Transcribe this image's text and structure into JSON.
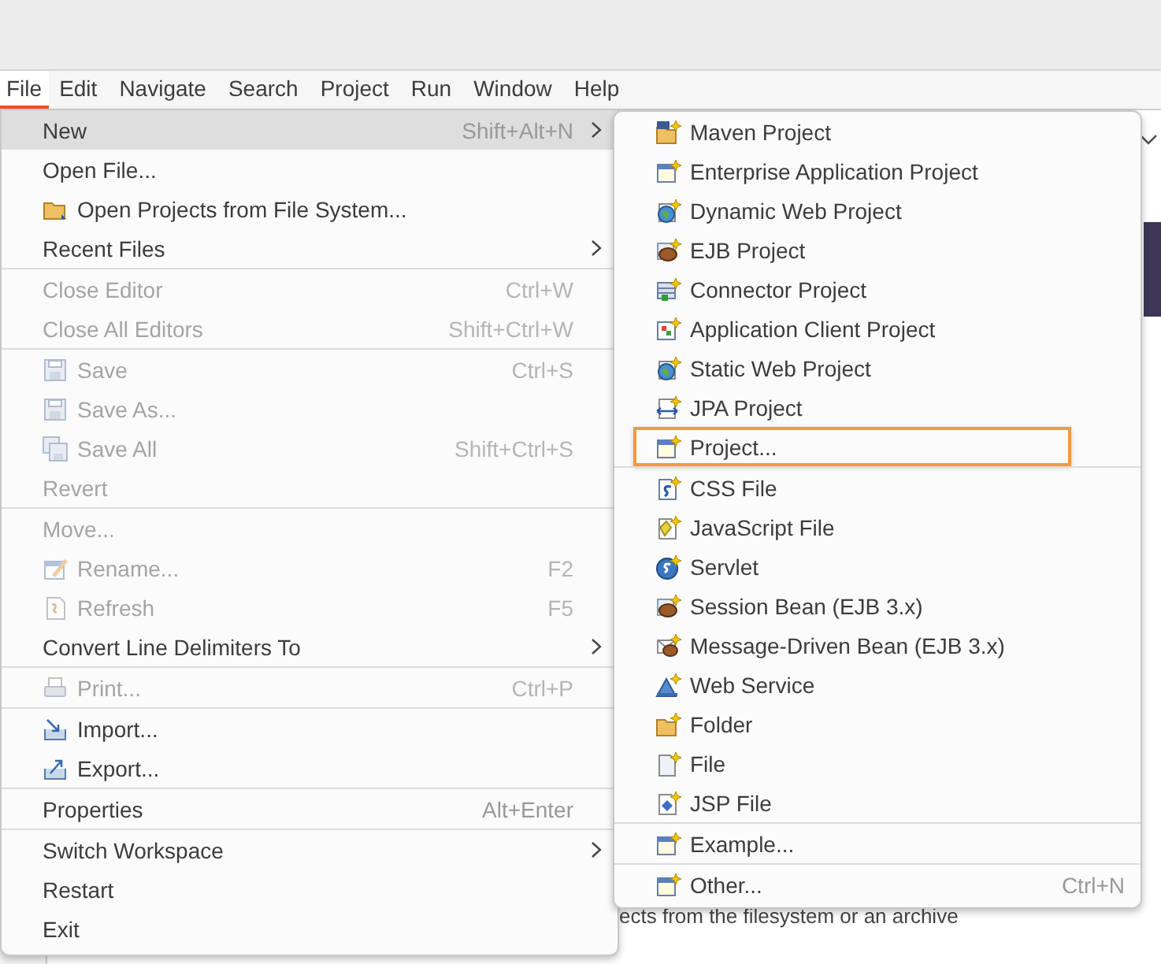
{
  "menubar": [
    {
      "label": "File",
      "selected": true
    },
    {
      "label": "Edit",
      "selected": false
    },
    {
      "label": "Navigate",
      "selected": false
    },
    {
      "label": "Search",
      "selected": false
    },
    {
      "label": "Project",
      "selected": false
    },
    {
      "label": "Run",
      "selected": false
    },
    {
      "label": "Window",
      "selected": false
    },
    {
      "label": "Help",
      "selected": false
    }
  ],
  "background": {
    "text": "ects from the filesystem or an archive"
  },
  "file_menu": {
    "groups": [
      [
        {
          "label": "New",
          "shortcut": "Shift+Alt+N",
          "submenu": true,
          "disabled": false,
          "highlighted": true
        },
        {
          "label": "Open File...",
          "submenu": false,
          "disabled": false,
          "highlighted": false
        },
        {
          "label": "Open Projects from File System...",
          "submenu": false,
          "disabled": false,
          "highlighted": false
        },
        {
          "label": "Recent Files",
          "submenu": true,
          "disabled": false,
          "highlighted": false
        }
      ],
      [
        {
          "label": "Close Editor",
          "shortcut": "Ctrl+W",
          "submenu": false,
          "disabled": true,
          "highlighted": false
        },
        {
          "label": "Close All Editors",
          "shortcut": "Shift+Ctrl+W",
          "submenu": false,
          "disabled": true,
          "highlighted": false
        }
      ],
      [
        {
          "label": "Save",
          "shortcut": "Ctrl+S",
          "submenu": false,
          "disabled": true,
          "highlighted": false
        },
        {
          "label": "Save As...",
          "submenu": false,
          "disabled": true,
          "highlighted": false
        },
        {
          "label": "Save All",
          "shortcut": "Shift+Ctrl+S",
          "submenu": false,
          "disabled": true,
          "highlighted": false
        },
        {
          "label": "Revert",
          "submenu": false,
          "disabled": true,
          "highlighted": false
        }
      ],
      [
        {
          "label": "Move...",
          "submenu": false,
          "disabled": true,
          "highlighted": false
        },
        {
          "label": "Rename...",
          "shortcut": "F2",
          "submenu": false,
          "disabled": true,
          "highlighted": false
        },
        {
          "label": "Refresh",
          "shortcut": "F5",
          "submenu": false,
          "disabled": true,
          "highlighted": false
        },
        {
          "label": "Convert Line Delimiters To",
          "submenu": true,
          "disabled": false,
          "highlighted": false
        }
      ],
      [
        {
          "label": "Print...",
          "shortcut": "Ctrl+P",
          "submenu": false,
          "disabled": true,
          "highlighted": false
        }
      ],
      [
        {
          "label": "Import...",
          "submenu": false,
          "disabled": false,
          "highlighted": false
        },
        {
          "label": "Export...",
          "submenu": false,
          "disabled": false,
          "highlighted": false
        }
      ],
      [
        {
          "label": "Properties",
          "shortcut": "Alt+Enter",
          "submenu": false,
          "disabled": false,
          "highlighted": false
        }
      ],
      [
        {
          "label": "Switch Workspace",
          "submenu": true,
          "disabled": false,
          "highlighted": false
        },
        {
          "label": "Restart",
          "submenu": false,
          "disabled": false,
          "highlighted": false
        },
        {
          "label": "Exit",
          "submenu": false,
          "disabled": false,
          "highlighted": false
        }
      ]
    ]
  },
  "new_submenu": {
    "groups": [
      [
        {
          "label": "Maven Project",
          "outlined": false
        },
        {
          "label": "Enterprise Application Project",
          "outlined": false
        },
        {
          "label": "Dynamic Web Project",
          "outlined": false
        },
        {
          "label": "EJB Project",
          "outlined": false
        },
        {
          "label": "Connector Project",
          "outlined": false
        },
        {
          "label": "Application Client Project",
          "outlined": false
        },
        {
          "label": "Static Web Project",
          "outlined": false
        },
        {
          "label": "JPA Project",
          "outlined": false
        },
        {
          "label": "Project...",
          "outlined": true
        }
      ],
      [
        {
          "label": "CSS File",
          "outlined": false
        },
        {
          "label": "JavaScript File",
          "outlined": false
        },
        {
          "label": "Servlet",
          "outlined": false
        },
        {
          "label": "Session Bean (EJB 3.x)",
          "outlined": false
        },
        {
          "label": "Message-Driven Bean (EJB 3.x)",
          "outlined": false
        },
        {
          "label": "Web Service",
          "outlined": false
        },
        {
          "label": "Folder",
          "outlined": false
        },
        {
          "label": "File",
          "outlined": false
        },
        {
          "label": "JSP File",
          "outlined": false
        }
      ],
      [
        {
          "label": "Example...",
          "outlined": false
        }
      ],
      [
        {
          "label": "Other...",
          "shortcut": "Ctrl+N",
          "outlined": false
        }
      ]
    ]
  }
}
